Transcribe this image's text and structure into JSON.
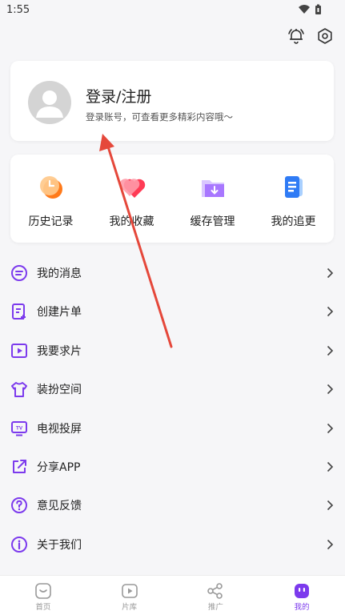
{
  "status_bar": {
    "time": "1:55"
  },
  "login": {
    "title": "登录/注册",
    "subtitle": "登录账号，可查看更多精彩内容哦～"
  },
  "quick_actions": [
    {
      "label": "历史记录",
      "icon": "history-icon"
    },
    {
      "label": "我的收藏",
      "icon": "favorites-icon"
    },
    {
      "label": "缓存管理",
      "icon": "cache-folder-icon"
    },
    {
      "label": "我的追更",
      "icon": "follow-updates-icon"
    }
  ],
  "menu": [
    {
      "label": "我的消息",
      "icon": "message-icon"
    },
    {
      "label": "创建片单",
      "icon": "create-list-icon"
    },
    {
      "label": "我要求片",
      "icon": "request-video-icon"
    },
    {
      "label": "装扮空间",
      "icon": "dress-up-icon"
    },
    {
      "label": "电视投屏",
      "icon": "tv-cast-icon"
    },
    {
      "label": "分享APP",
      "icon": "share-icon"
    },
    {
      "label": "意见反馈",
      "icon": "feedback-icon"
    },
    {
      "label": "关于我们",
      "icon": "info-icon"
    }
  ],
  "tabs": [
    {
      "label": "首页",
      "icon": "home-icon",
      "active": false
    },
    {
      "label": "片库",
      "icon": "library-icon",
      "active": false
    },
    {
      "label": "推广",
      "icon": "promote-share-icon",
      "active": false
    },
    {
      "label": "我的",
      "icon": "profile-icon",
      "active": true
    }
  ],
  "colors": {
    "accent": "#7c3aed",
    "annotation_arrow": "#e5483b"
  }
}
